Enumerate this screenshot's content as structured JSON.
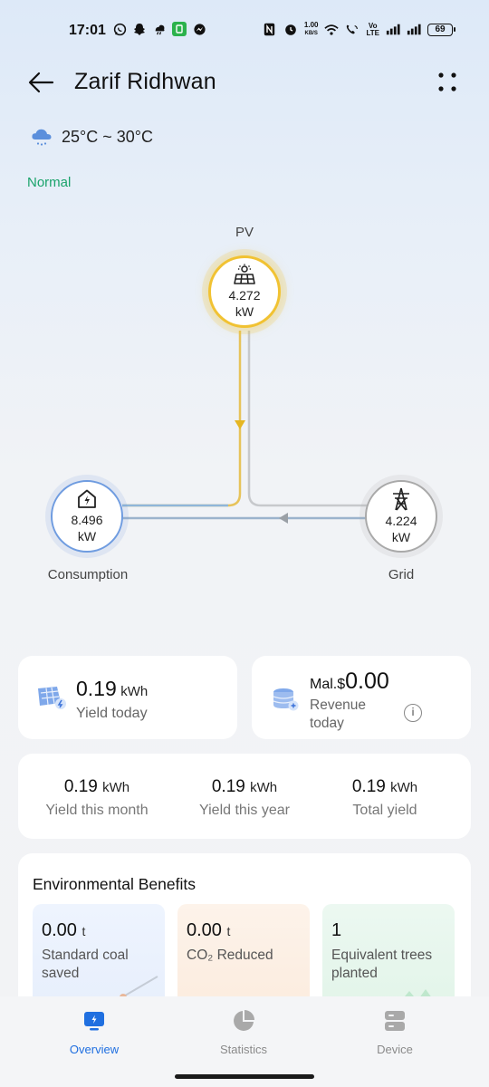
{
  "status_bar": {
    "time": "17:01",
    "net_speed_value": "1.00",
    "net_speed_unit": "KB/S",
    "volte_top": "Vo",
    "volte_bottom": "LTE",
    "battery": "69"
  },
  "header": {
    "title": "Zarif Ridhwan"
  },
  "weather": {
    "icon": "cloud-rain-icon",
    "range": "25°C ~ 30°C"
  },
  "plant_status": "Normal",
  "flow": {
    "pv": {
      "label": "PV",
      "value": "4.272",
      "unit": "kW"
    },
    "consumption": {
      "label": "Consumption",
      "value": "8.496",
      "unit": "kW"
    },
    "grid": {
      "label": "Grid",
      "value": "4.224",
      "unit": "kW"
    }
  },
  "yield_today": {
    "value": "0.19",
    "unit": "kWh",
    "label": "Yield today"
  },
  "revenue_today": {
    "currency": "Mal.$",
    "value": "0.00",
    "label": "Revenue today",
    "info": "i"
  },
  "stats": [
    {
      "value": "0.19",
      "unit": "kWh",
      "label": "Yield this month"
    },
    {
      "value": "0.19",
      "unit": "kWh",
      "label": "Yield this year"
    },
    {
      "value": "0.19",
      "unit": "kWh",
      "label": "Total yield"
    }
  ],
  "environment": {
    "title": "Environmental Benefits",
    "coal": {
      "value": "0.00",
      "unit": "t",
      "label": "Standard coal saved"
    },
    "co2": {
      "value": "0.00",
      "unit": "t",
      "label": "CO₂ Reduced"
    },
    "trees": {
      "value": "1",
      "label": "Equivalent trees planted"
    }
  },
  "nav": [
    {
      "label": "Overview",
      "icon": "overview-icon",
      "active": true
    },
    {
      "label": "Statistics",
      "icon": "pie-chart-icon",
      "active": false
    },
    {
      "label": "Device",
      "icon": "device-icon",
      "active": false
    }
  ],
  "colors": {
    "accent": "#1f6fe0",
    "normal": "#1aa36b",
    "pv": "#f1c232",
    "consumption": "#6f9ce0",
    "grid": "#a9a9a9"
  }
}
